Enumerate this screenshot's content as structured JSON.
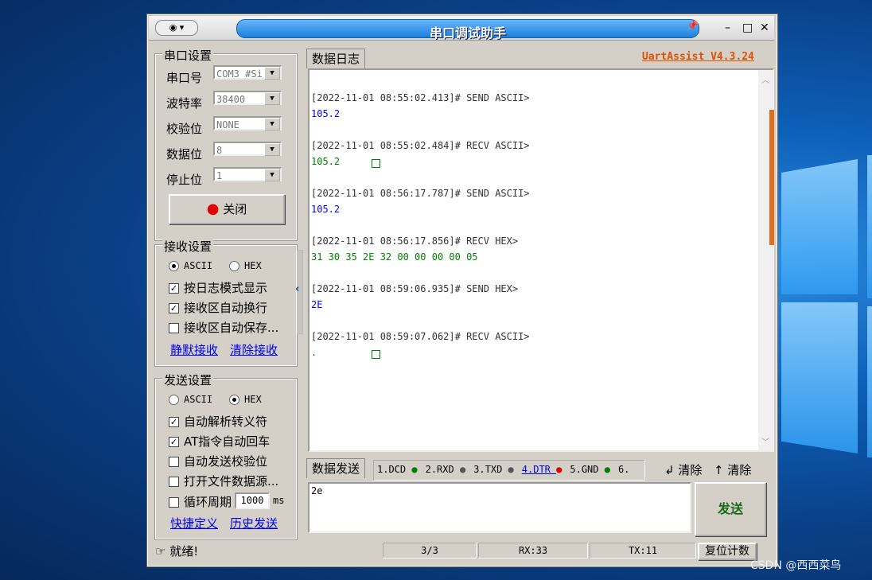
{
  "window": {
    "title": "串口调试助手",
    "menu_icon": "eye-icon",
    "pin_icon": "pin-icon"
  },
  "serial_settings": {
    "title": "串口设置",
    "port_label": "串口号",
    "port_value": "COM3 #Si]",
    "baud_label": "波特率",
    "baud_value": "38400",
    "parity_label": "校验位",
    "parity_value": "NONE",
    "databits_label": "数据位",
    "databits_value": "8",
    "stopbits_label": "停止位",
    "stopbits_value": "1",
    "open_button": "关闭"
  },
  "recv_settings": {
    "title": "接收设置",
    "ascii_label": "ASCII",
    "hex_label": "HEX",
    "selected": "ASCII",
    "log_mode": "按日志模式显示",
    "auto_wrap": "接收区自动换行",
    "auto_save": "接收区自动保存...",
    "link_mute": "静默接收",
    "link_clear": "清除接收"
  },
  "send_settings": {
    "title": "发送设置",
    "ascii_label": "ASCII",
    "hex_label": "HEX",
    "selected": "HEX",
    "escape": "自动解析转义符",
    "at_cr": "AT指令自动回车",
    "checksum": "自动发送校验位",
    "file_src": "打开文件数据源...",
    "cycle": "循环周期",
    "cycle_value": "1000",
    "cycle_unit": "ms",
    "link_shortcut": "快捷定义",
    "link_history": "历史发送"
  },
  "log_tab": "数据日志",
  "version_link": "UartAssist V4.3.24",
  "log": [
    {
      "header": "[2022-11-01 08:55:02.413]# SEND ASCII>",
      "data": "105.2",
      "color": "#0000ff"
    },
    {
      "header": "[2022-11-01 08:55:02.484]# RECV ASCII>",
      "data": "105.2",
      "color": "#008000",
      "box": true
    },
    {
      "header": "[2022-11-01 08:56:17.787]# SEND ASCII>",
      "data": "105.2",
      "color": "#0000ff"
    },
    {
      "header": "[2022-11-01 08:56:17.856]# RECV HEX>",
      "data": "31 30 35 2E 32 00 00 00 00 05",
      "color": "#008000"
    },
    {
      "header": "[2022-11-01 08:59:06.935]# SEND HEX>",
      "data": "2E",
      "color": "#0000ff"
    },
    {
      "header": "[2022-11-01 08:59:07.062]# RECV ASCII>",
      "data": ".",
      "color": "#008000",
      "box": true
    }
  ],
  "send_tab": "数据发送",
  "signals": [
    {
      "label": "1.DCD",
      "color": "#008000"
    },
    {
      "label": "2.RXD",
      "color": "#555555"
    },
    {
      "label": "3.TXD",
      "color": "#555555"
    },
    {
      "label": "4.DTR",
      "color": "#e00000"
    },
    {
      "label": "5.GND",
      "color": "#008000"
    },
    {
      "label": "6.",
      "color": "#000000"
    }
  ],
  "clear_left": "清除",
  "clear_right": "清除",
  "send_input": "2e",
  "send_button": "发送",
  "status": {
    "ready": "就绪!",
    "count": "3/3",
    "rx": "RX:33",
    "tx": "TX:11",
    "reset": "复位计数"
  },
  "watermark": "CSDN @西西菜鸟"
}
